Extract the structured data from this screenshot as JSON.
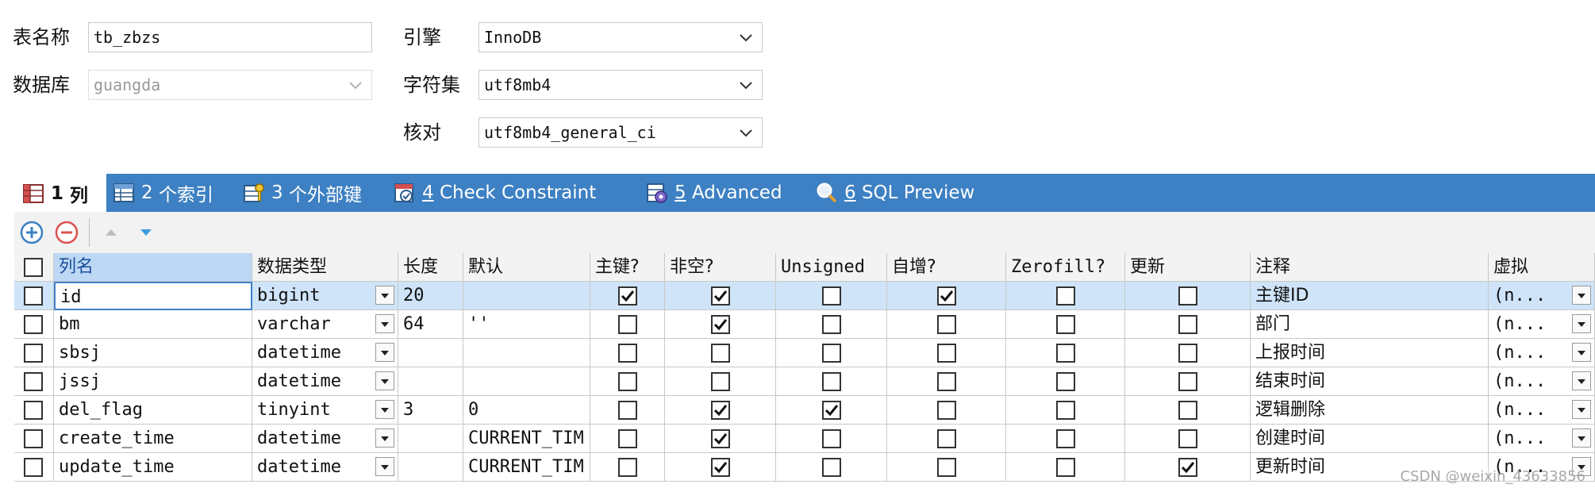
{
  "form": {
    "table_name_label": "表名称",
    "table_name_value": "tb_zbzs",
    "database_label": "数据库",
    "database_value": "guangda",
    "engine_label": "引擎",
    "engine_value": "InnoDB",
    "charset_label": "字符集",
    "charset_value": "utf8mb4",
    "collation_label": "核对",
    "collation_value": "utf8mb4_general_ci"
  },
  "tabs": [
    {
      "num": "1",
      "label": "列",
      "active": true
    },
    {
      "num": "2",
      "label": "个索引",
      "active": false
    },
    {
      "num": "3",
      "label": "个外部键",
      "active": false
    },
    {
      "num": "4",
      "label": "Check Constraint",
      "active": false
    },
    {
      "num": "5",
      "label": "Advanced",
      "active": false
    },
    {
      "num": "6",
      "label": "SQL Preview",
      "active": false
    }
  ],
  "columns_header": [
    "列名",
    "数据类型",
    "长度",
    "默认",
    "主键?",
    "非空?",
    "Unsigned",
    "自增?",
    "Zerofill?",
    "更新",
    "注释",
    "虚拟"
  ],
  "rows": [
    {
      "name": "id",
      "type": "bigint",
      "length": "20",
      "default": "",
      "pk": true,
      "notnull": true,
      "unsigned": false,
      "autoinc": true,
      "zerofill": false,
      "update": false,
      "comment": "主键ID",
      "virtual": "(n...",
      "selected": true
    },
    {
      "name": "bm",
      "type": "varchar",
      "length": "64",
      "default": "''",
      "pk": false,
      "notnull": true,
      "unsigned": false,
      "autoinc": false,
      "zerofill": false,
      "update": false,
      "comment": "部门",
      "virtual": "(n...",
      "selected": false
    },
    {
      "name": "sbsj",
      "type": "datetime",
      "length": "",
      "default": "",
      "pk": false,
      "notnull": false,
      "unsigned": false,
      "autoinc": false,
      "zerofill": false,
      "update": false,
      "comment": "上报时间",
      "virtual": "(n...",
      "selected": false
    },
    {
      "name": "jssj",
      "type": "datetime",
      "length": "",
      "default": "",
      "pk": false,
      "notnull": false,
      "unsigned": false,
      "autoinc": false,
      "zerofill": false,
      "update": false,
      "comment": "结束时间",
      "virtual": "(n...",
      "selected": false
    },
    {
      "name": "del_flag",
      "type": "tinyint",
      "length": "3",
      "default": "0",
      "pk": false,
      "notnull": true,
      "unsigned": true,
      "autoinc": false,
      "zerofill": false,
      "update": false,
      "comment": "逻辑删除",
      "virtual": "(n...",
      "selected": false
    },
    {
      "name": "create_time",
      "type": "datetime",
      "length": "",
      "default": "CURRENT_TIM",
      "pk": false,
      "notnull": true,
      "unsigned": false,
      "autoinc": false,
      "zerofill": false,
      "update": false,
      "comment": "创建时间",
      "virtual": "(n...",
      "selected": false
    },
    {
      "name": "update_time",
      "type": "datetime",
      "length": "",
      "default": "CURRENT_TIM",
      "pk": false,
      "notnull": true,
      "unsigned": false,
      "autoinc": false,
      "zerofill": false,
      "update": true,
      "comment": "更新时间",
      "virtual": "(n...",
      "selected": false
    }
  ],
  "watermark": "CSDN @weixin_43633856",
  "colors": {
    "tabbar": "#3d80c3",
    "header_active": "#bcd8f5",
    "row_selected": "#cfe4f9"
  }
}
